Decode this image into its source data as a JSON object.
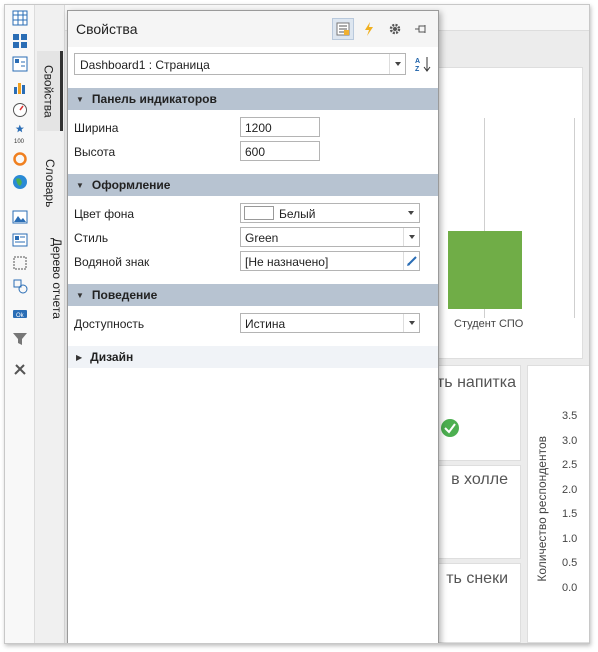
{
  "panel": {
    "title": "Свойства",
    "header_icons": [
      "properties-icon",
      "events-icon",
      "settings-icon",
      "pin-icon"
    ],
    "selector_value": "Dashboard1 : Страница",
    "sort_icon_text": "A Z"
  },
  "side_tabs": [
    "Свойства",
    "Словарь",
    "Дерево отчета"
  ],
  "sections": {
    "panel_indicators": {
      "label": "Панель индикаторов",
      "width_label": "Ширина",
      "width_value": "1200",
      "height_label": "Высота",
      "height_value": "600"
    },
    "design_look": {
      "label": "Оформление",
      "bg_color_label": "Цвет фона",
      "bg_color_value": "Белый",
      "bg_color_hex": "#ffffff",
      "style_label": "Стиль",
      "style_value": "Green",
      "watermark_label": "Водяной знак",
      "watermark_value": "[Не назначено]"
    },
    "behavior": {
      "label": "Поведение",
      "access_label": "Доступность",
      "access_value": "Истина"
    },
    "design": {
      "label": "Дизайн"
    }
  },
  "dashboard": {
    "bar_category": "Студент СПО",
    "bar_color": "#70ad47",
    "tile_texts": [
      "ть напитка",
      "в холле",
      "ть снеки"
    ],
    "y_axis_label": "Количество респондентов",
    "y_ticks": [
      "3.5",
      "3.0",
      "2.5",
      "2.0",
      "1.5",
      "1.0",
      "0.5",
      "0.0"
    ]
  }
}
